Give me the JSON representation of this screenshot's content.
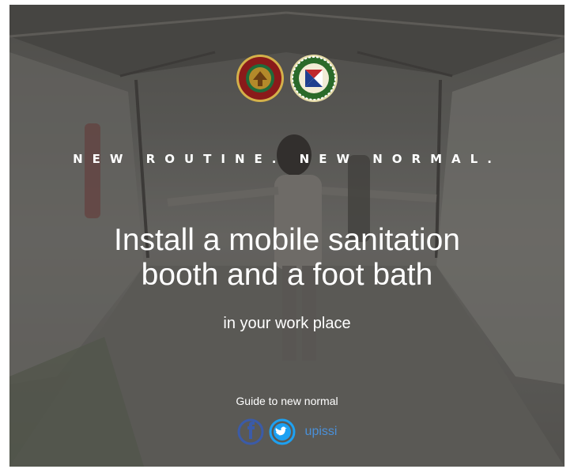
{
  "poster": {
    "tagline": "NEW ROUTINE. NEW NORMAL.",
    "headline_line1": "Install a mobile sanitation",
    "headline_line2": "booth and a foot bath",
    "subline": "in your work place",
    "guide_label": "Guide to new normal",
    "social_handle": "upissi"
  },
  "icons": {
    "logo_left": "university-seal-logo",
    "logo_right": "institute-seal-logo",
    "facebook": "facebook-icon",
    "twitter": "twitter-icon"
  },
  "colors": {
    "text": "#ffffff",
    "facebook": "#3b5ba8",
    "twitter": "#1da1f2",
    "handle": "#4a90d9",
    "seal_left": "#8a1a1a",
    "seal_right": "#2a6a2a"
  }
}
